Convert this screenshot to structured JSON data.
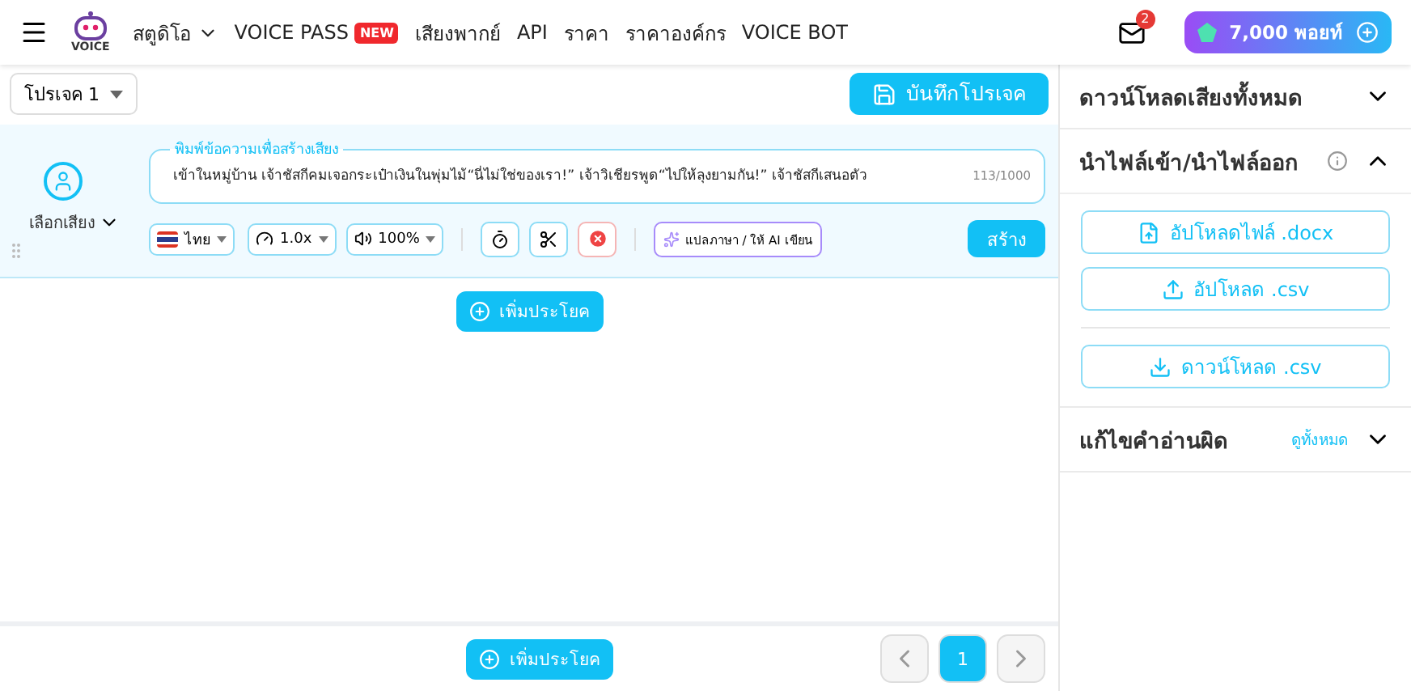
{
  "nav": {
    "logo": "VOICE",
    "items": [
      {
        "label": "สตูดิโอ",
        "dropdown": true
      },
      {
        "label": "VOICE PASS",
        "badge": "NEW"
      },
      {
        "label": "เสียงพากย์"
      },
      {
        "label": "API"
      },
      {
        "label": "ราคา"
      },
      {
        "label": "ราคาองค์กร"
      },
      {
        "label": "VOICE BOT"
      }
    ],
    "mail_count": "2",
    "points": "7,000 พอยท์"
  },
  "toolbar": {
    "project": "โปรเจค 1",
    "save": "บันทึกโปรเจค"
  },
  "sentences": [
    {
      "voice_label": "เลือกเสียง",
      "field_label": "พิมพ์ข้อความเพื่อสร้างเสียง",
      "text": "เข้าในหมู่บ้าน เจ้าชัสกีคมเจอกระเป๋าเงินในพุ่มไม้“นี่ไม่ใช่ของเรา!” เจ้าวิเชียรพูด“ไปให้ลุงยามกัน!” เจ้าชัสกีเสนอตัว",
      "count": "113/1000",
      "language": "ไทย",
      "speed": "1.0x",
      "volume": "100%",
      "translate": "แปลภาษา / ให้ AI เขียน",
      "create": "สร้าง"
    }
  ],
  "add_sentence": "เพิ่มประโยค",
  "footer": {
    "add_sentence": "เพิ่มประโยค",
    "pages": [
      {
        "label": "1",
        "selected": true
      }
    ]
  },
  "sidebar": {
    "sections": [
      {
        "title": "ดาวน์โหลดเสียงทั้งหมด",
        "expanded": false
      },
      {
        "title": "นำไฟล์เข้า/นำไฟล์ออก",
        "expanded": true,
        "info": true,
        "buttons": [
          {
            "label": "อัปโหลดไฟล์ .docx",
            "kind": "doc"
          },
          {
            "label": "อัปโหลด .csv",
            "kind": "upload"
          },
          {
            "label": "ดาวน์โหลด .csv",
            "kind": "download",
            "divider": true
          }
        ]
      },
      {
        "title": "แก้ไขคำอ่านผิด",
        "expanded": false,
        "link": "ดูทั้งหมด"
      }
    ]
  }
}
